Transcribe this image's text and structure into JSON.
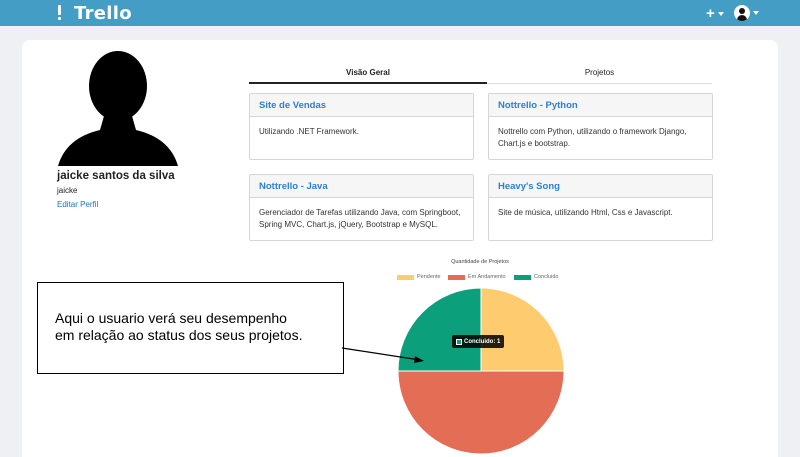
{
  "header": {
    "brand": "Trello",
    "add_symbol": "+"
  },
  "profile": {
    "name": "jaicke santos da silva",
    "username": "jaicke",
    "edit_link": "Editar Perfil"
  },
  "tabs": [
    {
      "label": "Visão Geral",
      "active": true
    },
    {
      "label": "Projetos",
      "active": false
    }
  ],
  "projects": [
    {
      "title": "Site de Vendas",
      "description": "Utilizando .NET Framework."
    },
    {
      "title": "Nottrello - Python",
      "description": "Nottrello com Python, utilizando o framework Django, Chart.js e bootstrap."
    },
    {
      "title": "Nottrello - Java",
      "description": "Gerenciador de Tarefas utilizando Java, com Springboot, Spring MVC, Chart.js, jQuery, Bootstrap e MySQL."
    },
    {
      "title": "Heavy's Song",
      "description": "Site de música, utilizando Html, Css e Javascript."
    }
  ],
  "chart": {
    "tooltip": "Concluido: 1"
  },
  "chart_data": {
    "type": "pie",
    "title": "Quantidade de Projetos",
    "categories": [
      "Pendente",
      "Em Andamento",
      "Concluido"
    ],
    "values": [
      1,
      2,
      1
    ],
    "colors": [
      "#fecc6e",
      "#e46e55",
      "#0b9f7c"
    ],
    "legend_position": "top"
  },
  "annotation": {
    "line1": "Aqui o usuario verá seu desempenho",
    "line2": "em relação ao status dos seus projetos."
  }
}
